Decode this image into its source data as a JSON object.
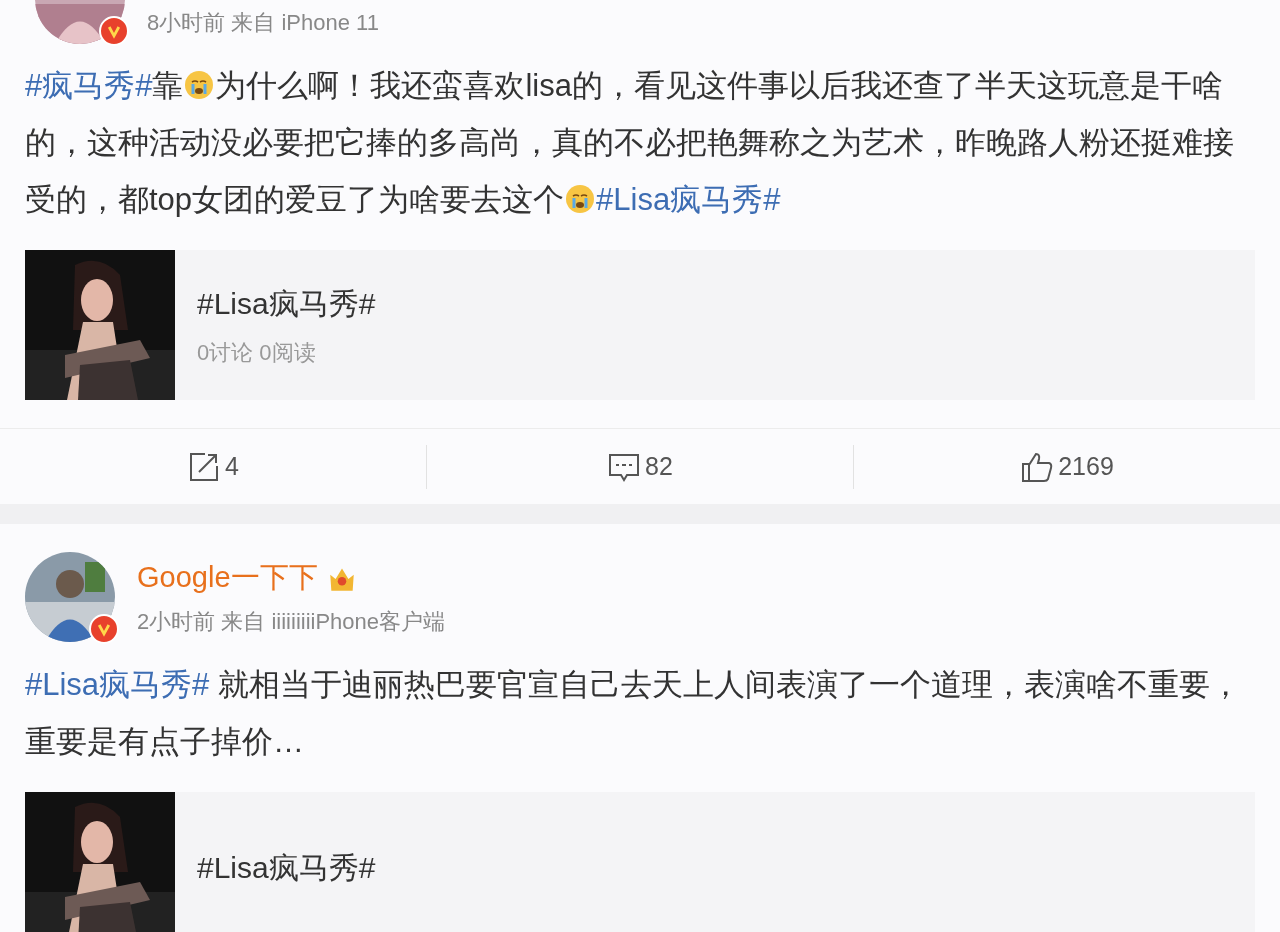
{
  "posts": [
    {
      "verified": true,
      "meta": "8小时前 来自 iPhone 11",
      "body": [
        {
          "kind": "tag",
          "text": "#疯马秀#"
        },
        {
          "kind": "text",
          "text": "靠"
        },
        {
          "kind": "emoji"
        },
        {
          "kind": "text",
          "text": "为什么啊！我还蛮喜欢lisa的，看见这件事以后我还查了半天这玩意是干啥的，这种活动没必要把它捧的多高尚，真的不必把艳舞称之为艺术，昨晚路人粉还挺难接受的，都top女团的爱豆了为啥要去这个"
        },
        {
          "kind": "emoji"
        },
        {
          "kind": "tag",
          "text": "#Lisa疯马秀#"
        }
      ],
      "topic": {
        "title": "#Lisa疯马秀#",
        "stats": "0讨论 0阅读"
      },
      "actions": [
        {
          "kind": "repost",
          "count": "4"
        },
        {
          "kind": "comment",
          "count": "82"
        },
        {
          "kind": "like",
          "count": "2169"
        }
      ]
    },
    {
      "verified": true,
      "name": "Google一下下",
      "crown": true,
      "meta": "2小时前 来自 iiiiiiiiiPhone客户端",
      "body": [
        {
          "kind": "tag",
          "text": "#Lisa疯马秀#"
        },
        {
          "kind": "text",
          "text": " 就相当于迪丽热巴要官宣自己去天上人间表演了一个道理，表演啥不重要，重要是有点子掉价…"
        }
      ],
      "topic": {
        "title": "#Lisa疯马秀#"
      }
    }
  ]
}
